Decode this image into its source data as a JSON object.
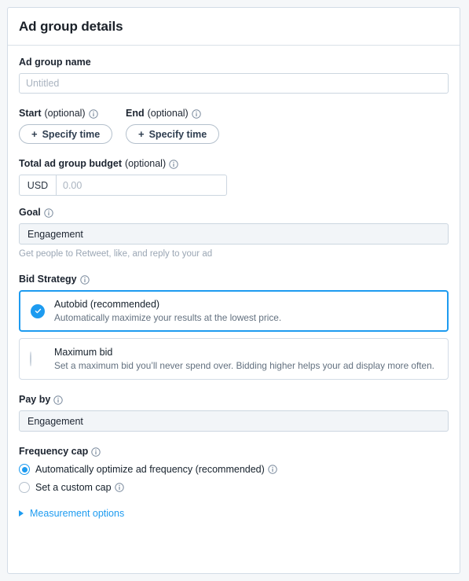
{
  "card": {
    "title": "Ad group details"
  },
  "ad_group_name": {
    "label": "Ad group name",
    "placeholder": "Untitled",
    "value": ""
  },
  "schedule": {
    "start": {
      "label": "Start",
      "optional": "(optional)",
      "button_label": "Specify time",
      "plus": "+"
    },
    "end": {
      "label": "End",
      "optional": "(optional)",
      "button_label": "Specify time",
      "plus": "+"
    }
  },
  "budget": {
    "label": "Total ad group budget",
    "optional": "(optional)",
    "currency": "USD",
    "placeholder": "0.00",
    "value": ""
  },
  "goal": {
    "label": "Goal",
    "value": "Engagement",
    "hint": "Get people to Retweet, like, and reply to your ad"
  },
  "bid_strategy": {
    "label": "Bid Strategy",
    "options": [
      {
        "title": "Autobid (recommended)",
        "description": "Automatically maximize your results at the lowest price.",
        "selected": true,
        "marker": "check-circle-icon"
      },
      {
        "title": "Maximum bid",
        "description": "Set a maximum bid you’ll never spend over. Bidding higher helps your ad display more often.",
        "selected": false,
        "marker": "empty-circle-icon"
      }
    ]
  },
  "pay_by": {
    "label": "Pay by",
    "value": "Engagement"
  },
  "frequency_cap": {
    "label": "Frequency cap",
    "options": [
      {
        "label": "Automatically optimize ad frequency (recommended)",
        "selected": true
      },
      {
        "label": "Set a custom cap",
        "selected": false
      }
    ]
  },
  "measurement": {
    "label": "Measurement options",
    "expanded": false
  },
  "colors": {
    "accent": "#1d9bf0",
    "page_bg": "#f5f7f9",
    "card_bg": "#ffffff",
    "border": "#d3dce6",
    "text": "#15202b",
    "muted": "#62707f"
  }
}
